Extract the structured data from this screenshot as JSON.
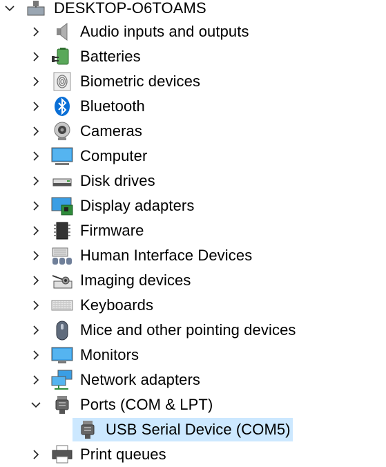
{
  "root": {
    "label": "DESKTOP-O6TOAMS",
    "icon": "computer-root-icon",
    "expanded": true
  },
  "categories": [
    {
      "label": "Audio inputs and outputs",
      "icon": "speaker-icon",
      "expanded": false
    },
    {
      "label": "Batteries",
      "icon": "battery-icon",
      "expanded": false
    },
    {
      "label": "Biometric devices",
      "icon": "fingerprint-icon",
      "expanded": false
    },
    {
      "label": "Bluetooth",
      "icon": "bluetooth-icon",
      "expanded": false
    },
    {
      "label": "Cameras",
      "icon": "camera-icon",
      "expanded": false
    },
    {
      "label": "Computer",
      "icon": "computer-icon",
      "expanded": false
    },
    {
      "label": "Disk drives",
      "icon": "disk-drive-icon",
      "expanded": false
    },
    {
      "label": "Display adapters",
      "icon": "display-adapter-icon",
      "expanded": false
    },
    {
      "label": "Firmware",
      "icon": "chip-icon",
      "expanded": false
    },
    {
      "label": "Human Interface Devices",
      "icon": "hid-icon",
      "expanded": false
    },
    {
      "label": "Imaging devices",
      "icon": "scanner-icon",
      "expanded": false
    },
    {
      "label": "Keyboards",
      "icon": "keyboard-icon",
      "expanded": false
    },
    {
      "label": "Mice and other pointing devices",
      "icon": "mouse-icon",
      "expanded": false
    },
    {
      "label": "Monitors",
      "icon": "monitor-icon",
      "expanded": false
    },
    {
      "label": "Network adapters",
      "icon": "network-icon",
      "expanded": false
    },
    {
      "label": "Ports (COM & LPT)",
      "icon": "port-icon",
      "expanded": true,
      "children": [
        {
          "label": "USB Serial Device (COM5)",
          "icon": "serial-port-icon",
          "selected": true
        }
      ]
    },
    {
      "label": "Print queues",
      "icon": "printer-icon",
      "expanded": false
    }
  ],
  "colors": {
    "selection": "#cce8ff",
    "accent": "#0078d7"
  }
}
